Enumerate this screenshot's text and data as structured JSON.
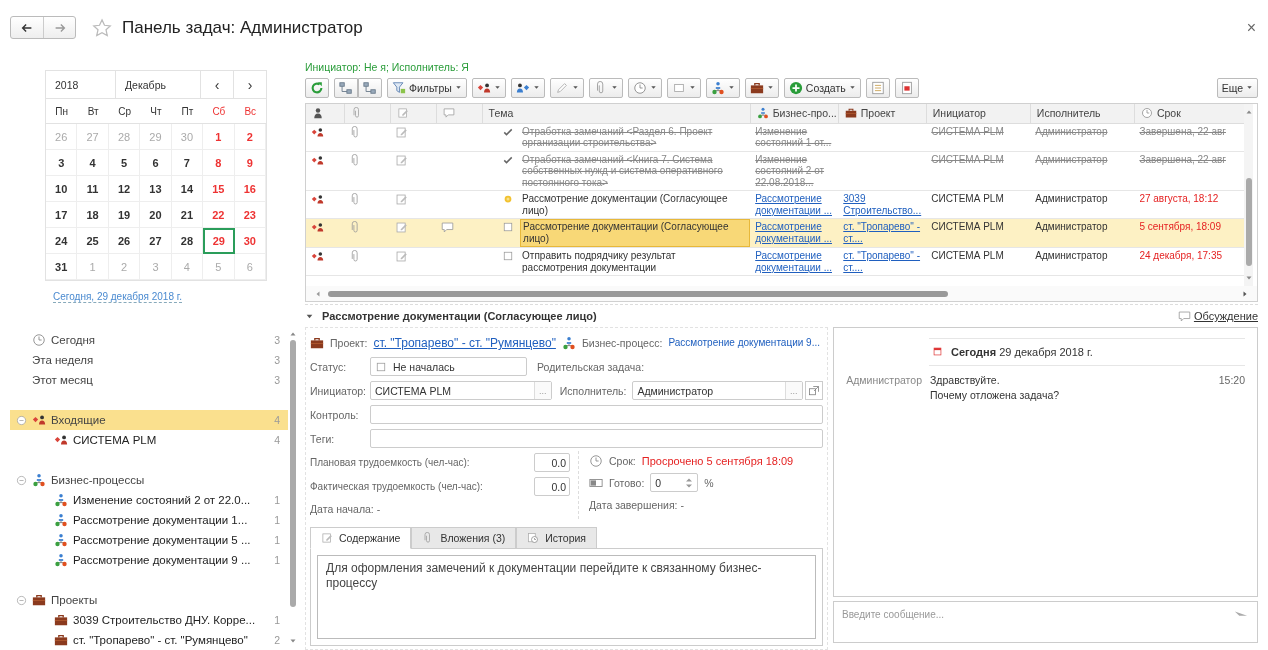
{
  "window": {
    "title": "Панель задач: Администратор",
    "close": "×"
  },
  "calendar": {
    "year": "2018",
    "month": "Декабрь",
    "prev": "‹",
    "next": "›",
    "weekdays": [
      {
        "label": "Пн",
        "weekend": false
      },
      {
        "label": "Вт",
        "weekend": false
      },
      {
        "label": "Ср",
        "weekend": false
      },
      {
        "label": "Чт",
        "weekend": false
      },
      {
        "label": "Пт",
        "weekend": false
      },
      {
        "label": "Сб",
        "weekend": true
      },
      {
        "label": "Вс",
        "weekend": true
      }
    ],
    "days": [
      {
        "label": "26",
        "outside": true,
        "selected": false
      },
      {
        "label": "27",
        "outside": true,
        "selected": false
      },
      {
        "label": "28",
        "outside": true,
        "selected": false
      },
      {
        "label": "29",
        "outside": true,
        "selected": false
      },
      {
        "label": "30",
        "outside": true,
        "selected": false
      },
      {
        "label": "1",
        "outside": false,
        "selected": false
      },
      {
        "label": "2",
        "outside": false,
        "selected": false
      },
      {
        "label": "3",
        "outside": false,
        "selected": false
      },
      {
        "label": "4",
        "outside": false,
        "selected": false
      },
      {
        "label": "5",
        "outside": false,
        "selected": false
      },
      {
        "label": "6",
        "outside": false,
        "selected": false
      },
      {
        "label": "7",
        "outside": false,
        "selected": false
      },
      {
        "label": "8",
        "outside": false,
        "selected": false
      },
      {
        "label": "9",
        "outside": false,
        "selected": false
      },
      {
        "label": "10",
        "outside": false,
        "selected": false
      },
      {
        "label": "11",
        "outside": false,
        "selected": false
      },
      {
        "label": "12",
        "outside": false,
        "selected": false
      },
      {
        "label": "13",
        "outside": false,
        "selected": false
      },
      {
        "label": "14",
        "outside": false,
        "selected": false
      },
      {
        "label": "15",
        "outside": false,
        "selected": false
      },
      {
        "label": "16",
        "outside": false,
        "selected": false
      },
      {
        "label": "17",
        "outside": false,
        "selected": false
      },
      {
        "label": "18",
        "outside": false,
        "selected": false
      },
      {
        "label": "19",
        "outside": false,
        "selected": false
      },
      {
        "label": "20",
        "outside": false,
        "selected": false
      },
      {
        "label": "21",
        "outside": false,
        "selected": false
      },
      {
        "label": "22",
        "outside": false,
        "selected": false
      },
      {
        "label": "23",
        "outside": false,
        "selected": false
      },
      {
        "label": "24",
        "outside": false,
        "selected": false
      },
      {
        "label": "25",
        "outside": false,
        "selected": false
      },
      {
        "label": "26",
        "outside": false,
        "selected": false
      },
      {
        "label": "27",
        "outside": false,
        "selected": false
      },
      {
        "label": "28",
        "outside": false,
        "selected": false
      },
      {
        "label": "29",
        "outside": false,
        "selected": true
      },
      {
        "label": "30",
        "outside": false,
        "selected": false
      },
      {
        "label": "31",
        "outside": false,
        "selected": false
      },
      {
        "label": "1",
        "outside": true,
        "selected": false
      },
      {
        "label": "2",
        "outside": true,
        "selected": false
      },
      {
        "label": "3",
        "outside": true,
        "selected": false
      },
      {
        "label": "4",
        "outside": true,
        "selected": false
      },
      {
        "label": "5",
        "outside": true,
        "selected": false
      },
      {
        "label": "6",
        "outside": true,
        "selected": false
      }
    ],
    "today_link": "Сегодня, 29 декабря 2018 г."
  },
  "periods": [
    {
      "label": "Сегодня",
      "count": "3",
      "kind": "today",
      "selected": false
    },
    {
      "label": "Эта неделя",
      "count": "3",
      "kind": "week",
      "selected": false
    },
    {
      "label": "Этот месяц",
      "count": "3",
      "kind": "month",
      "selected": false
    }
  ],
  "tree": [
    {
      "label": "Входящие",
      "count": "4",
      "kind": "incoming",
      "expanded": true,
      "selected": true,
      "children": [
        {
          "label": "СИСТЕМА PLM",
          "count": "4",
          "selected": false
        }
      ]
    },
    {
      "label": "Бизнес-процессы",
      "kind": "process",
      "expanded": true,
      "selected": false,
      "children": [
        {
          "label": "Изменение состояний 2 от 22.0...",
          "count": "1",
          "selected": false
        },
        {
          "label": "Рассмотрение документации 1...",
          "count": "1",
          "selected": false
        },
        {
          "label": "Рассмотрение документации 5 ...",
          "count": "1",
          "selected": false
        },
        {
          "label": "Рассмотрение документации 9 ...",
          "count": "1",
          "selected": false
        }
      ]
    },
    {
      "label": "Проекты",
      "kind": "project",
      "expanded": true,
      "selected": false,
      "children": [
        {
          "label": "3039 Строительство ДНУ. Корре...",
          "count": "1",
          "selected": false
        },
        {
          "label": "ст. \"Тропарево\" - ст. \"Румянцево\"",
          "count": "2",
          "selected": false
        }
      ]
    }
  ],
  "filter_caption": "Инициатор: Не я; Исполнитель: Я",
  "toolbar": {
    "filters": "Фильтры",
    "create": "Создать",
    "more": "Еще"
  },
  "table": {
    "columns": [
      {
        "label": "Тема",
        "kind": "text"
      },
      {
        "label": "Бизнес-про...",
        "kind": "process"
      },
      {
        "label": "Проект",
        "kind": "project"
      },
      {
        "label": "Инициатор",
        "kind": "text"
      },
      {
        "label": "Исполнитель",
        "kind": "text"
      },
      {
        "label": "Срок",
        "kind": "due"
      }
    ],
    "rows": [
      {
        "kind": "done",
        "selected": false,
        "has_comment": false,
        "overdue": false,
        "subject": "Отработка замечаний <Раздел 6. Проект организации строительства>",
        "process": "Изменение состояний 1 от...",
        "initiator": "СИСТЕМА PLM",
        "executor": "Администратор",
        "due": "Завершена, 22 авг"
      },
      {
        "kind": "done",
        "selected": false,
        "has_comment": false,
        "overdue": false,
        "subject": "Отработка замечаний <Книга 7. Система собственных нужд и система оперативного постоянного тока>",
        "process": "Изменение состояний 2 от 22.08.2018...",
        "initiator": "СИСТЕМА PLM",
        "executor": "Администратор",
        "due": "Завершена, 22 авг"
      },
      {
        "kind": "in_progress",
        "selected": false,
        "has_comment": false,
        "overdue": true,
        "subject": "Рассмотрение документации (Согласующее лицо)",
        "process": "Рассмотрение документации ...",
        "project": "3039 Строительство...",
        "initiator": "СИСТЕМА PLM",
        "executor": "Администратор",
        "due": "27 августа, 18:12"
      },
      {
        "kind": "new",
        "selected": true,
        "has_comment": true,
        "overdue": true,
        "subject": "Рассмотрение документации (Согласующее лицо)",
        "process": "Рассмотрение документации ...",
        "project": "ст. \"Тропарево\" - ст....",
        "initiator": "СИСТЕМА PLM",
        "executor": "Администратор",
        "due": "5 сентября, 18:09"
      },
      {
        "kind": "new",
        "selected": false,
        "has_comment": false,
        "overdue": true,
        "subject": "Отправить подрядчику результат рассмотрения документации",
        "process": "Рассмотрение документации ...",
        "project": "ст. \"Тропарево\" - ст....",
        "initiator": "СИСТЕМА PLM",
        "executor": "Администратор",
        "due": "24 декабря, 17:35"
      }
    ]
  },
  "details": {
    "title": "Рассмотрение документации (Согласующее лицо)",
    "expanded": true,
    "project_label": "Проект:",
    "project": "ст. \"Тропарево\" - ст. \"Румянцево\"",
    "process_label": "Бизнес-процесс:",
    "process": "Рассмотрение документации 9...",
    "status_label": "Статус:",
    "status": "Не началась",
    "parent_label": "Родительская задача:",
    "initiator_label": "Инициатор:",
    "initiator": "СИСТЕМА PLM",
    "executor_label": "Исполнитель:",
    "executor": "Администратор",
    "choose": "...",
    "control_label": "Контроль:",
    "tags_label": "Теги:",
    "planned_label": "Плановая трудоемкость (чел-час):",
    "planned": "0.0",
    "actual_label": "Фактическая трудоемкость (чел-час):",
    "actual": "0.0",
    "start_label": "Дата начала: -",
    "due_label": "Срок:",
    "due": "Просрочено 5 сентября 18:09",
    "ready_label": "Готово:",
    "ready": "0",
    "percent": "%",
    "end_label": "Дата завершения: -",
    "tabs": [
      {
        "label": "Содержание",
        "kind": "content",
        "selected": true
      },
      {
        "label": "Вложения (3)",
        "kind": "attachments",
        "selected": false
      },
      {
        "label": "История",
        "kind": "history",
        "selected": false
      }
    ],
    "content": "Для оформления замечений к документации перейдите к связанному бизнес-процессу"
  },
  "discussion": {
    "link": "Обсуждение",
    "date": "**Сегодня** 29 декабря 2018 г.",
    "messages": [
      {
        "author": "Администратор",
        "lines": [
          "Здравствуйте.",
          "Почему отложена задача?"
        ],
        "time": "15:20"
      }
    ],
    "placeholder": "Введите сообщение..."
  }
}
